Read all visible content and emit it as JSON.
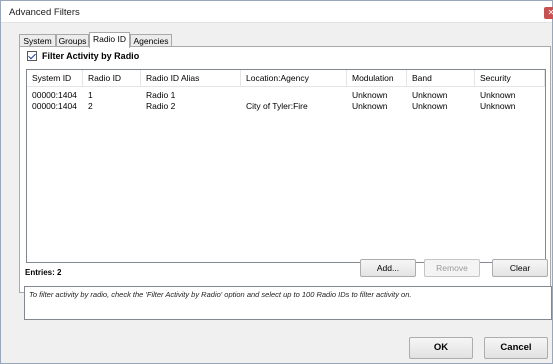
{
  "window": {
    "title": "Advanced Filters",
    "close_glyph": "✕"
  },
  "tabs": [
    {
      "label": "System"
    },
    {
      "label": "Groups"
    },
    {
      "label": "Radio ID"
    },
    {
      "label": "Agencies"
    }
  ],
  "active_tab": "Radio ID",
  "filter": {
    "label": "Filter Activity by Radio",
    "checked": true
  },
  "list": {
    "columns": [
      "System ID",
      "Radio ID",
      "Radio ID Alias",
      "Location:Agency",
      "Modulation",
      "Band",
      "Security"
    ],
    "rows": [
      [
        "00000:1404",
        "1",
        "Radio 1",
        "",
        "Unknown",
        "Unknown",
        "Unknown"
      ],
      [
        "00000:1404",
        "2",
        "Radio 2",
        "City of Tyler:Fire",
        "Unknown",
        "Unknown",
        "Unknown"
      ]
    ]
  },
  "entries_label": "Entries: 2",
  "buttons": {
    "add": "Add...",
    "remove": "Remove",
    "clear": "Clear",
    "ok": "OK",
    "cancel": "Cancel"
  },
  "hint": "To filter activity by radio, check the 'Filter Activity by Radio' option and select up to 100 Radio IDs to filter activity on.",
  "icons": {
    "close": "close-icon",
    "check": "checkmark-icon"
  },
  "colors": {
    "close_button": "#c75050",
    "check": "#1e3f9b"
  }
}
